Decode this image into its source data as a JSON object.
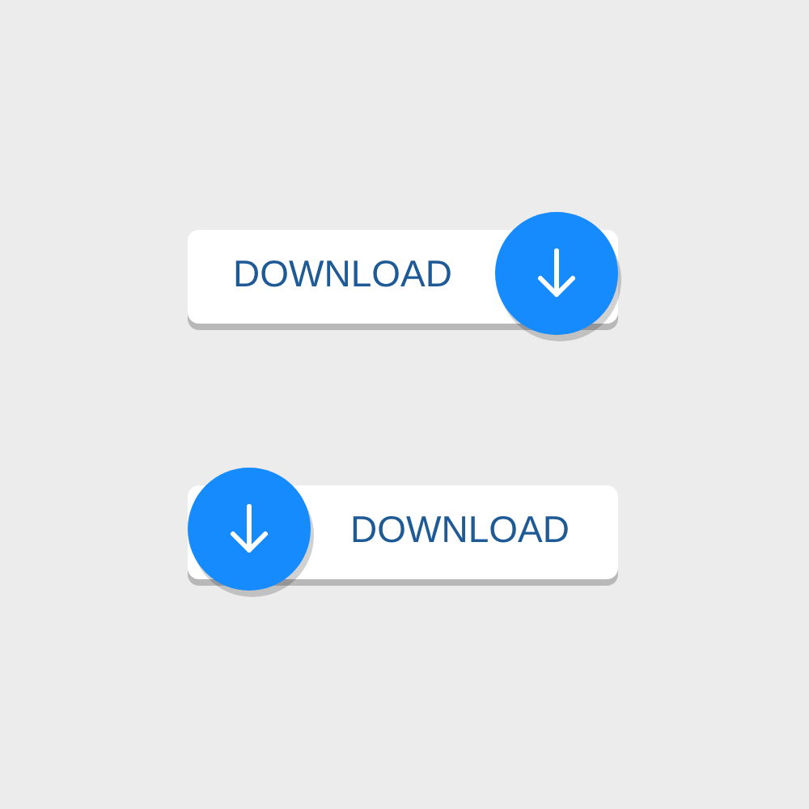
{
  "buttons": [
    {
      "label": "DOWNLOAD",
      "kind": "icon-right"
    },
    {
      "label": "DOWNLOAD",
      "kind": "icon-left"
    }
  ]
}
